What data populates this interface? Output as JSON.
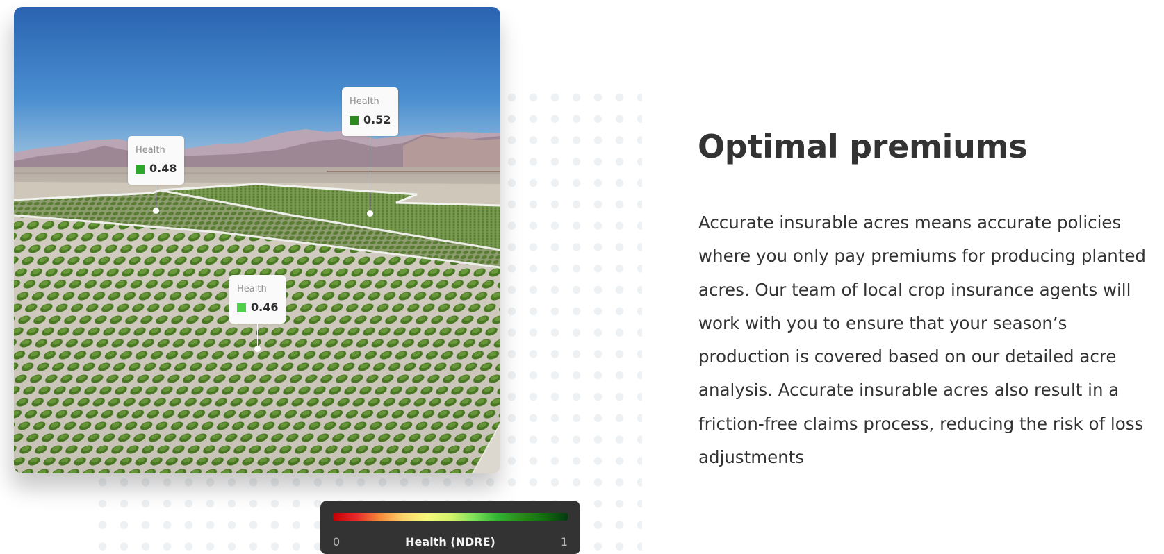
{
  "image_card": {
    "description": "Aerial photo of orchard field rows with desert mountains on horizon",
    "tags": [
      {
        "label": "Health",
        "value": "0.48",
        "swatch_color": "#2ea82a"
      },
      {
        "label": "Health",
        "value": "0.52",
        "swatch_color": "#2d8a1e"
      },
      {
        "label": "Health",
        "value": "0.46",
        "swatch_color": "#4fcf4a"
      }
    ]
  },
  "legend": {
    "title": "Health (NDRE)",
    "min_label": "0",
    "max_label": "1",
    "gradient_colors": [
      "#c40000",
      "#e8292b",
      "#f48a3a",
      "#fed36c",
      "#f6f97a",
      "#d3f46a",
      "#7fe05a",
      "#32b334",
      "#2a8a1c",
      "#136d0d",
      "#043a10"
    ]
  },
  "section": {
    "heading": "Optimal premiums",
    "paragraph_lines": [
      "Accurate insurable acres means accurate policies",
      "where you only pay premiums for producing planted",
      "acres. Our team of local crop insurance agents will",
      "work with you to ensure that your season’s",
      "production is covered based on our detailed acre",
      "analysis. Accurate insurable acres also result in a",
      "friction-free claims process, reducing the risk of loss",
      "adjustments"
    ]
  },
  "colors": {
    "text": "#333333",
    "legend_bg": "#333333",
    "dot_pattern": "#eef1f3",
    "sky_top": "#2a63b1"
  }
}
